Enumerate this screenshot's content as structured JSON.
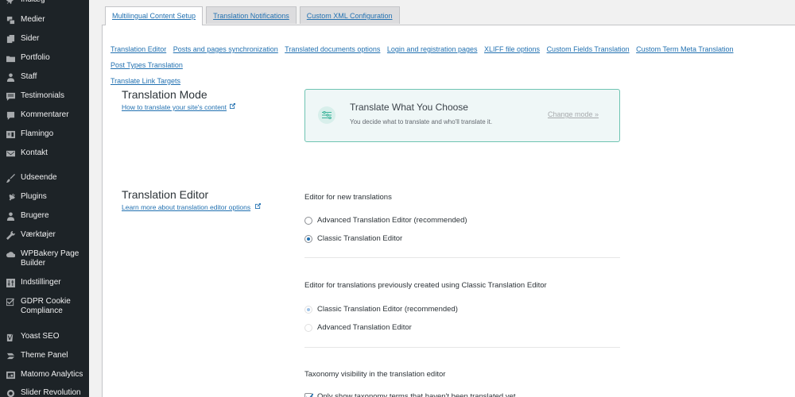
{
  "sidebar": {
    "items": [
      {
        "label": "Indlæg",
        "icon": "pin-icon"
      },
      {
        "label": "Medier",
        "icon": "media-icon"
      },
      {
        "label": "Sider",
        "icon": "pages-icon"
      },
      {
        "label": "Portfolio",
        "icon": "folder-icon"
      },
      {
        "label": "Staff",
        "icon": "user-icon"
      },
      {
        "label": "Testimonials",
        "icon": "testimonial-icon"
      },
      {
        "label": "Kommentarer",
        "icon": "comment-icon"
      },
      {
        "label": "Flamingo",
        "icon": "address-card-icon"
      },
      {
        "label": "Kontakt",
        "icon": "mail-icon"
      },
      {
        "label": "Udseende",
        "icon": "brush-icon"
      },
      {
        "label": "Plugins",
        "icon": "plugin-icon"
      },
      {
        "label": "Brugere",
        "icon": "users-icon"
      },
      {
        "label": "Værktøjer",
        "icon": "wrench-icon"
      },
      {
        "label": "WPBakery Page Builder",
        "icon": "cloud-icon"
      },
      {
        "label": "Indstillinger",
        "icon": "settings-icon"
      },
      {
        "label": "GDPR Cookie Compliance",
        "icon": "checkbox-icon"
      },
      {
        "label": "Yoast SEO",
        "icon": "yoast-icon"
      },
      {
        "label": "Theme Panel",
        "icon": "theme-panel-icon"
      },
      {
        "label": "Matomo Analytics",
        "icon": "analytics-icon"
      },
      {
        "label": "Slider Revolution",
        "icon": "slider-icon"
      }
    ]
  },
  "tabs": [
    {
      "label": "Multilingual Content Setup",
      "active": true
    },
    {
      "label": "Translation Notifications",
      "active": false
    },
    {
      "label": "Custom XML Configuration",
      "active": false
    }
  ],
  "sublinks": [
    "Translation Editor",
    "Posts and pages synchronization",
    "Translated documents options",
    "Login and registration pages",
    "XLIFF file options",
    "Custom Fields Translation",
    "Custom Term Meta Translation",
    "Post Types Translation",
    "Translate Link Targets"
  ],
  "translation_mode": {
    "title": "Translation Mode",
    "help_link": "How to translate your site's content",
    "card_title": "Translate What You Choose",
    "card_desc": "You decide what to translate and who'll translate it.",
    "change_link": "Change mode »"
  },
  "translation_editor": {
    "title": "Translation Editor",
    "help_link": "Learn more about translation editor options",
    "new_label": "Editor for new translations",
    "new_options": [
      {
        "label": "Advanced Translation Editor (recommended)",
        "checked": false
      },
      {
        "label": "Classic Translation Editor",
        "checked": true
      }
    ],
    "prev_label": "Editor for translations previously created using Classic Translation Editor",
    "prev_options": [
      {
        "label": "Classic Translation Editor (recommended)",
        "checked": true,
        "disabled": true
      },
      {
        "label": "Advanced Translation Editor",
        "checked": false,
        "disabled": true
      }
    ],
    "taxonomy_label": "Taxonomy visibility in the translation editor",
    "taxonomy_checkbox": {
      "label": "Only show taxonomy terms that haven't been translated yet",
      "checked": true
    }
  },
  "colors": {
    "sidebar_bg": "#1d2327",
    "link": "#2271b1",
    "card_border": "#6fc4b2",
    "card_bg": "#eff7f7"
  }
}
